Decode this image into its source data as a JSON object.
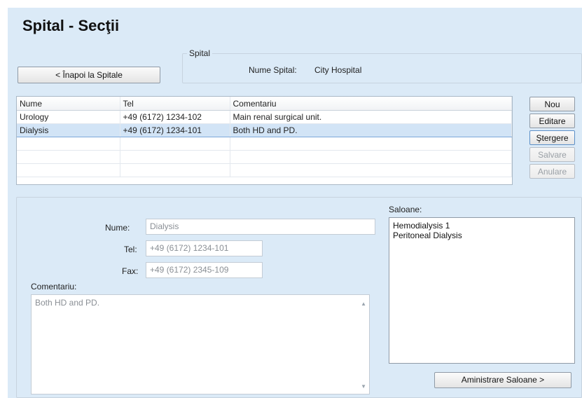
{
  "page_title": "Spital - Secţii",
  "back_button": "< Înapoi la Spitale",
  "hospital_group": {
    "legend": "Spital",
    "name_label": "Nume Spital:",
    "name_value": "City Hospital"
  },
  "grid": {
    "columns": [
      "Nume",
      "Tel",
      "Comentariu"
    ],
    "rows": [
      {
        "nume": "Urology",
        "tel": "+49 (6172) 1234-102",
        "comentariu": "Main renal surgical unit."
      },
      {
        "nume": "Dialysis",
        "tel": "+49 (6172) 1234-101",
        "comentariu": "Both HD and PD."
      }
    ]
  },
  "side_buttons": {
    "nou": "Nou",
    "editare": "Editare",
    "stergere": "Ştergere",
    "salvare": "Salvare",
    "anulare": "Anulare"
  },
  "details": {
    "nume_label": "Nume:",
    "nume_value": "Dialysis",
    "tel_label": "Tel:",
    "tel_value": "+49 (6172) 1234-101",
    "fax_label": "Fax:",
    "fax_value": "+49 (6172) 2345-109",
    "comentariu_label": "Comentariu:",
    "comentariu_value": "Both HD and PD."
  },
  "saloane": {
    "label": "Saloane:",
    "items": [
      "Hemodialysis 1",
      "Peritoneal Dialysis"
    ],
    "manage_button": "Aministrare Saloane >"
  }
}
